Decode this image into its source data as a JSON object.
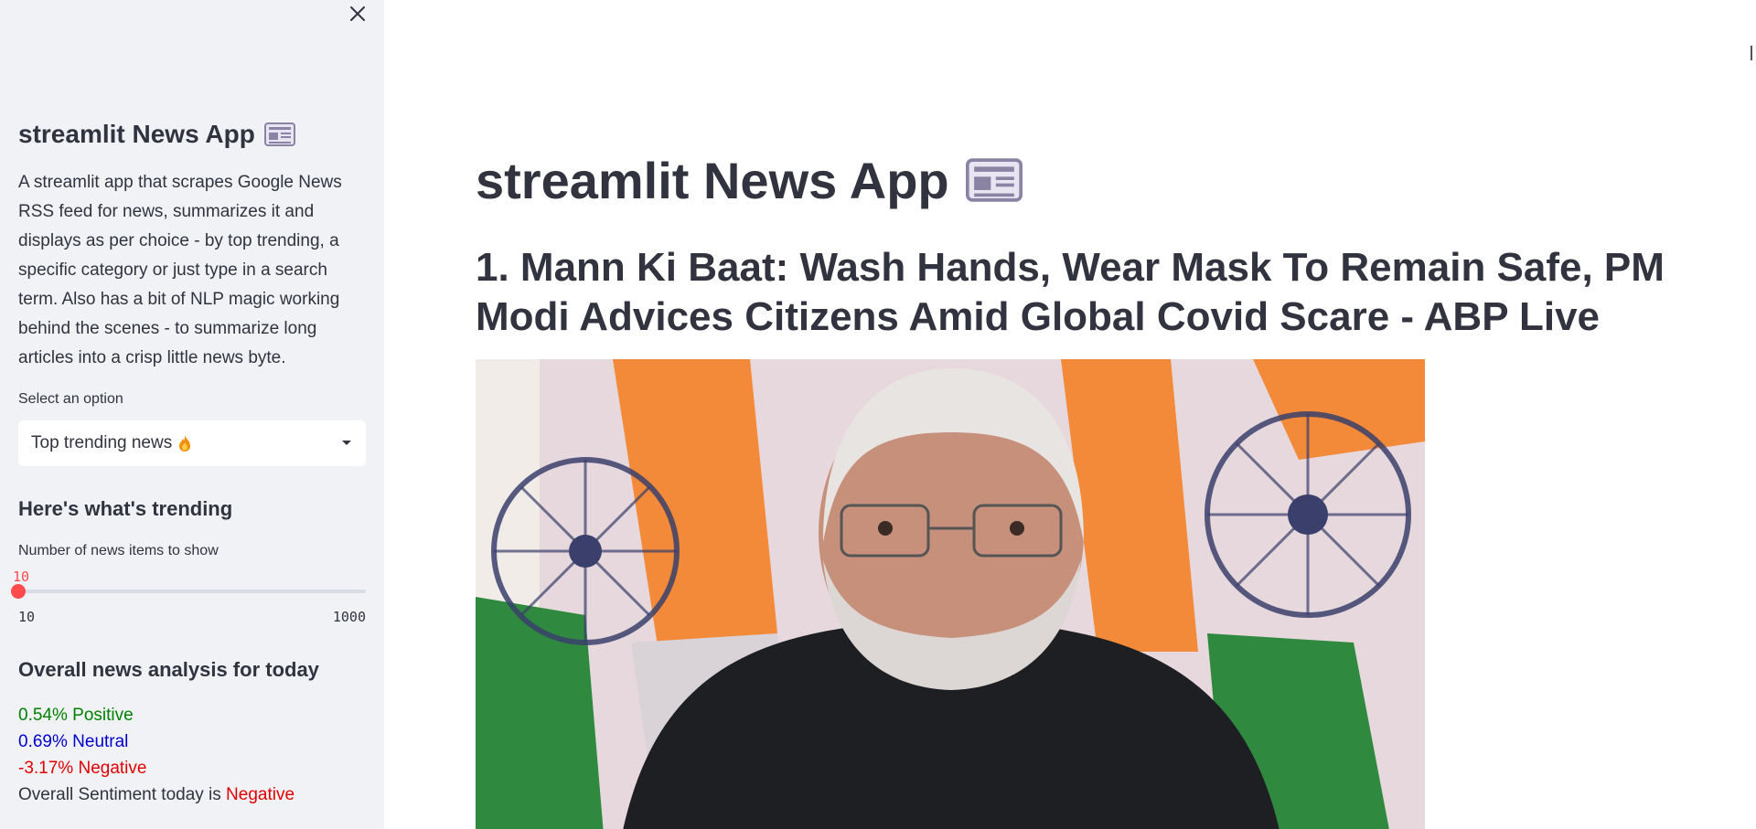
{
  "sidebar": {
    "title": "streamlit News App",
    "title_icon": "newspaper-icon",
    "description": "A streamlit app that scrapes Google News RSS feed for news, summarizes it and displays as per choice - by top trending, a specific category or just type in a search term. Also has a bit of NLP magic working behind the scenes - to summarize long articles into a crisp little news byte.",
    "select_label": "Select an option",
    "select_value": "Top trending news",
    "select_icon": "fire-icon",
    "trending_heading": "Here's what's trending",
    "slider_label": "Number of news items to show",
    "slider_value": "10",
    "slider_min": "10",
    "slider_max": "1000",
    "slider_level": 0.0,
    "analysis_heading": "Overall news analysis for today",
    "positive": "0.54% Positive",
    "neutral": "0.69% Neutral",
    "negative": "-3.17% Negative",
    "overall_prefix": "Overall Sentiment today is ",
    "overall_value": "Negative"
  },
  "main": {
    "title": "streamlit News App",
    "headline": "1. Mann Ki Baat: Wash Hands, Wear Mask To Remain Safe, PM Modi Advices Citizens Amid Global Covid Scare - ABP Live"
  },
  "colors": {
    "sidebar_bg": "#f0f2f6",
    "accent": "#ff4b4b",
    "positive": "#008000",
    "neutral": "#0000cd",
    "negative": "#e00000"
  }
}
